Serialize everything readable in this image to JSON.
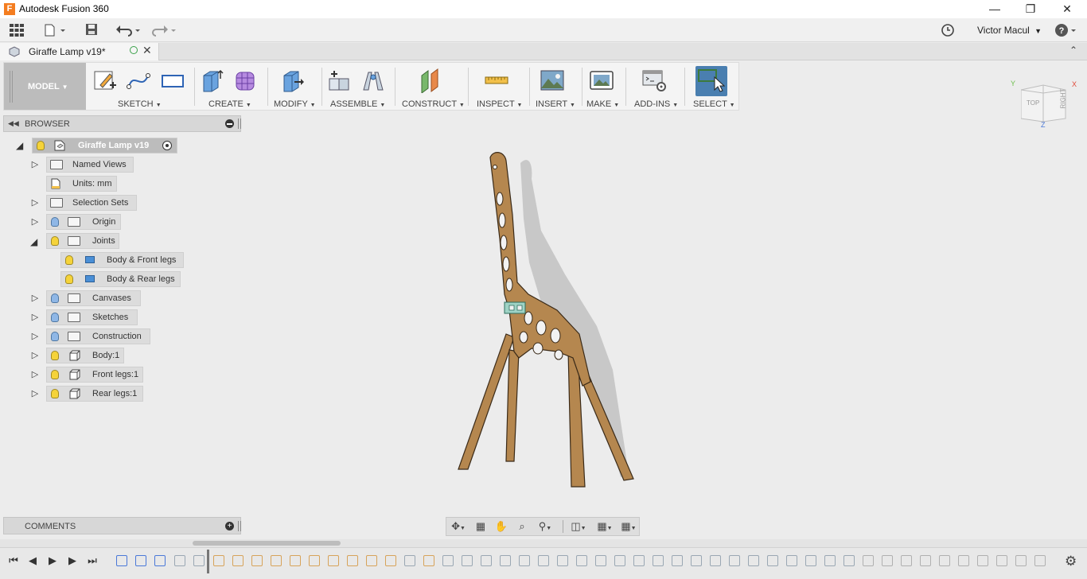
{
  "window": {
    "app_title": "Autodesk Fusion 360",
    "logo_letter": "F"
  },
  "quick_access": {
    "user_name": "Victor Macul"
  },
  "document_tab": {
    "title": "Giraffe Lamp v19*"
  },
  "toolbar": {
    "workspace": "MODEL",
    "groups": [
      {
        "label": "SKETCH"
      },
      {
        "label": "CREATE"
      },
      {
        "label": "MODIFY"
      },
      {
        "label": "ASSEMBLE"
      },
      {
        "label": "CONSTRUCT"
      },
      {
        "label": "INSPECT"
      },
      {
        "label": "INSERT"
      },
      {
        "label": "MAKE"
      },
      {
        "label": "ADD-INS"
      },
      {
        "label": "SELECT"
      }
    ]
  },
  "browser": {
    "title": "BROWSER",
    "root": "Giraffe Lamp v19",
    "items": [
      {
        "label": "Named Views"
      },
      {
        "label": "Units: mm"
      },
      {
        "label": "Selection Sets"
      },
      {
        "label": "Origin"
      },
      {
        "label": "Joints"
      },
      {
        "label": "Body & Front legs"
      },
      {
        "label": "Body & Rear legs"
      },
      {
        "label": "Canvases"
      },
      {
        "label": "Sketches"
      },
      {
        "label": "Construction"
      },
      {
        "label": "Body:1"
      },
      {
        "label": "Front legs:1"
      },
      {
        "label": "Rear legs:1"
      }
    ]
  },
  "comments": {
    "title": "COMMENTS"
  },
  "viewcube": {
    "top_label": "TOP",
    "right_label": "RIGHT",
    "axis_x": "X",
    "axis_y": "Y",
    "axis_z": "Z"
  },
  "colors": {
    "accent": "#4a7fb0",
    "model_wood": "#b5874f",
    "bulb_on": "#f5d33a",
    "bulb_off": "#8fb7e6"
  }
}
